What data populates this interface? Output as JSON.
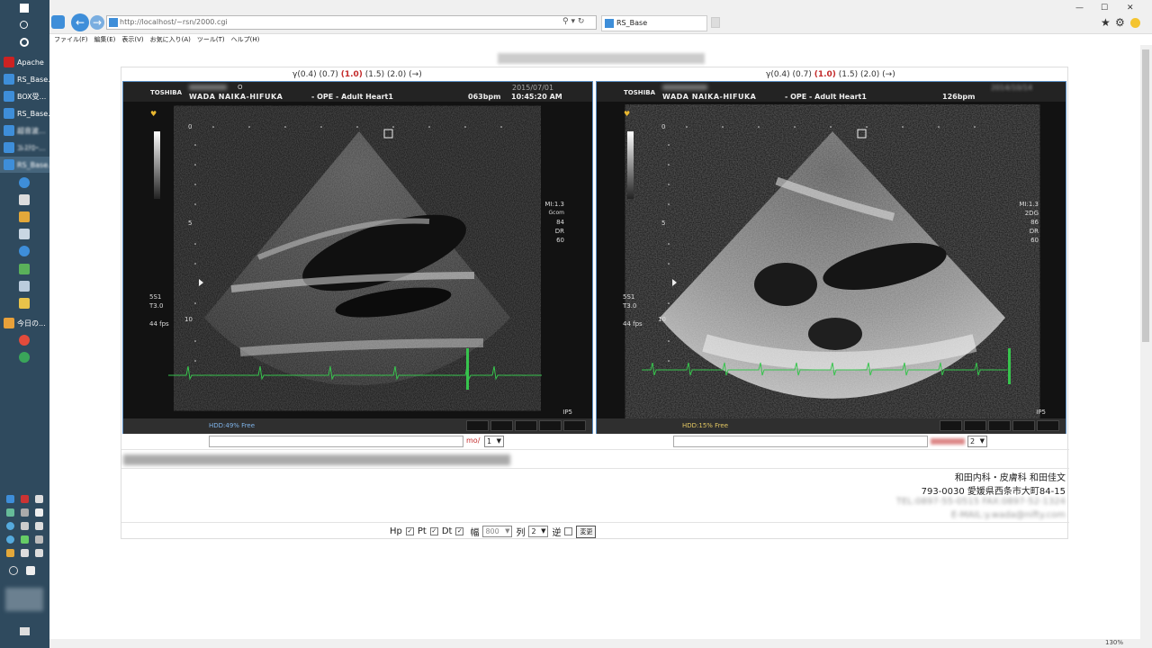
{
  "taskbar": {
    "buttons": [
      {
        "label": "Apache"
      },
      {
        "label": "RS_Base..."
      },
      {
        "label": "BOX受..."
      },
      {
        "label": "RS_Base..."
      },
      {
        "label": "超音波..."
      },
      {
        "label": "ｺﾚｽﾃﾛｰ..."
      },
      {
        "label": "RS_Base..."
      },
      {
        "label": "今日の..."
      }
    ]
  },
  "browser": {
    "address": "http://localhost/~rsn/2000.cgi",
    "tab_title": "RS_Base",
    "menu": [
      "ファイル(F)",
      "編集(E)",
      "表示(V)",
      "お気に入り(A)",
      "ツール(T)",
      "ヘルプ(H)"
    ],
    "zoom": "130%"
  },
  "viewers": [
    {
      "gamma": {
        "pre": "γ(0.4) (0.7) ",
        "active": "(1.0)",
        "post": " (1.5) (2.0) (→)"
      },
      "header": {
        "brand": "TOSHIBA",
        "id_mark": "O",
        "clinic": "WADA NAIKA-HIFUKA",
        "mode": "- OPE -   Adult Heart1",
        "bpm": "063bpm",
        "time": "10:45:20 AM",
        "date": "2015/07/01"
      },
      "depth_labels": [
        "0",
        "5",
        "10"
      ],
      "right_params": [
        "MI:1.3",
        "Gcom",
        "84",
        "DR",
        "60"
      ],
      "left_params": [
        "5S1",
        "T3.0",
        "",
        "44 fps"
      ],
      "probe": "IP5",
      "hdd": "HDD:49% Free",
      "hdd_color": "#7fb4ea",
      "input_suffix": "mo/",
      "select": "1"
    },
    {
      "gamma": {
        "pre": "γ(0.4) (0.7) ",
        "active": "(1.0)",
        "post": " (1.5) (2.0) (→)"
      },
      "header": {
        "brand": "TOSHIBA",
        "id_mark": "",
        "clinic": "WADA NAIKA-HIFUKA",
        "mode": "- OPE -   Adult Heart1",
        "bpm": "126bpm",
        "time": "",
        "date": "2014/10/14"
      },
      "depth_labels": [
        "0",
        "5",
        "10"
      ],
      "right_params": [
        "MI:1.3",
        "2DG",
        "86",
        "DR",
        "60"
      ],
      "left_params": [
        "5S1",
        "T3.0",
        "",
        "44 fps"
      ],
      "probe": "IP5",
      "hdd": "HDD:15% Free",
      "hdd_color": "#e4c862",
      "input_suffix": "",
      "select": "2"
    }
  ],
  "address_block": {
    "line1": "和田内科・皮膚科 和田佳文",
    "line2": "793-0030 愛媛県西条市大町84-15",
    "line3": "TEL:0897-55-0515 FAX:0897-52-1324",
    "line4": "E-MAIL:y.wada@nifty.com"
  },
  "controls": {
    "hp": "Hp",
    "pt": "Pt",
    "dt": "Dt",
    "width_label": "幅",
    "width_value": "800",
    "col_label": "列",
    "col_value": "2",
    "reverse_label": "逆",
    "change_button": "変更"
  }
}
